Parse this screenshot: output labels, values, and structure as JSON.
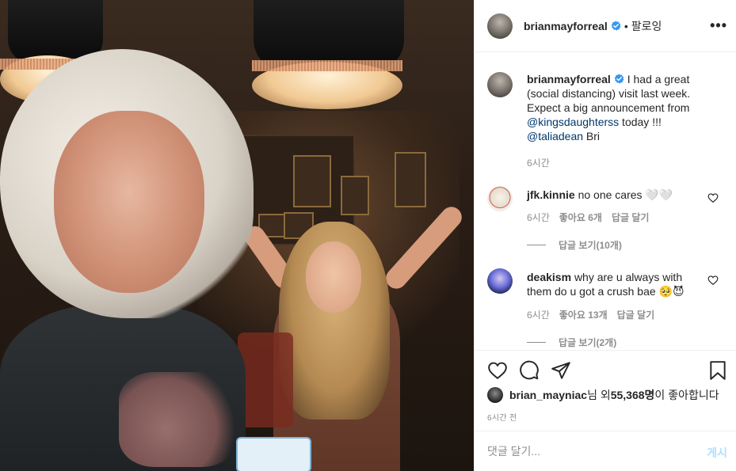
{
  "header": {
    "username": "brianmayforreal",
    "separator": "•",
    "follow_state": "팔로잉",
    "more_icon": "•••"
  },
  "caption": {
    "username": "brianmayforreal",
    "text_part1": "I had a great (social distancing) visit last week. Expect a big announcement from ",
    "mention1": "@kingsdaughterss",
    "text_part2": " today !!! ",
    "mention2": "@taliadean",
    "text_part3": " Bri",
    "time": "6시간"
  },
  "comments": [
    {
      "username": "jfk.kinnie",
      "text": "no one cares 🤍🤍",
      "time": "6시간",
      "likes": "좋아요 6개",
      "reply": "답글 달기",
      "view_replies": "답글 보기(10개)"
    },
    {
      "username": "deakism",
      "text": "why are u always with them do u got a crush bae 🥺😈",
      "time": "6시간",
      "likes": "좋아요 13개",
      "reply": "답글 달기",
      "view_replies": "답글 보기(2개)"
    }
  ],
  "likes": {
    "liker": "brian_mayniac",
    "suffix_1": "님 외 ",
    "count": "55,368명",
    "suffix_2": "이 좋아합니다"
  },
  "post_time": "6시간 전",
  "add_comment": {
    "placeholder": "댓글 달기...",
    "post_label": "게시"
  },
  "colors": {
    "verified": "#3897f0",
    "mention": "#00376b",
    "muted": "#8e8e8e",
    "post_button": "#b2dffc"
  }
}
